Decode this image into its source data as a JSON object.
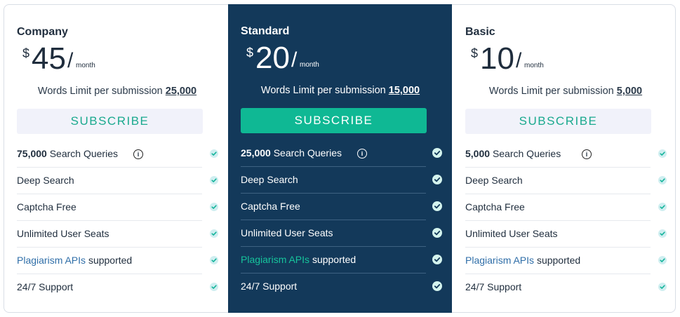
{
  "plans": [
    {
      "name": "Company",
      "currency": "$",
      "amount": "45",
      "slash": "/",
      "period": "month",
      "words_limit_label": "Words Limit per submission",
      "words_limit_value": "25,000",
      "subscribe_label": "SUBSCRIBE",
      "features": {
        "queries_count": "75,000",
        "queries_label": "Search Queries",
        "deep_search": "Deep Search",
        "captcha": "Captcha Free",
        "seats": "Unlimited User Seats",
        "apis_link": "Plagiarism APIs",
        "apis_text": "supported",
        "support": "24/7 Support"
      }
    },
    {
      "name": "Standard",
      "currency": "$",
      "amount": "20",
      "slash": "/",
      "period": "month",
      "words_limit_label": "Words Limit per submission",
      "words_limit_value": "15,000",
      "subscribe_label": "SUBSCRIBE",
      "features": {
        "queries_count": "25,000",
        "queries_label": "Search Queries",
        "deep_search": "Deep Search",
        "captcha": "Captcha Free",
        "seats": "Unlimited User Seats",
        "apis_link": "Plagiarism APIs",
        "apis_text": "supported",
        "support": "24/7 Support"
      }
    },
    {
      "name": "Basic",
      "currency": "$",
      "amount": "10",
      "slash": "/",
      "period": "month",
      "words_limit_label": "Words Limit per submission",
      "words_limit_value": "5,000",
      "subscribe_label": "SUBSCRIBE",
      "features": {
        "queries_count": "5,000",
        "queries_label": "Search Queries",
        "deep_search": "Deep Search",
        "captcha": "Captcha Free",
        "seats": "Unlimited User Seats",
        "apis_link": "Plagiarism APIs",
        "apis_text": "supported",
        "support": "24/7 Support"
      }
    }
  ],
  "info_icon_glyph": "i",
  "icons": {
    "info": "info-icon",
    "check": "check-icon"
  },
  "colors": {
    "highlight_background": "#13395a",
    "accent_green": "#0fb894",
    "link_blue": "#2f6ea8",
    "subscribe_light_bg": "#f1f2fa"
  }
}
